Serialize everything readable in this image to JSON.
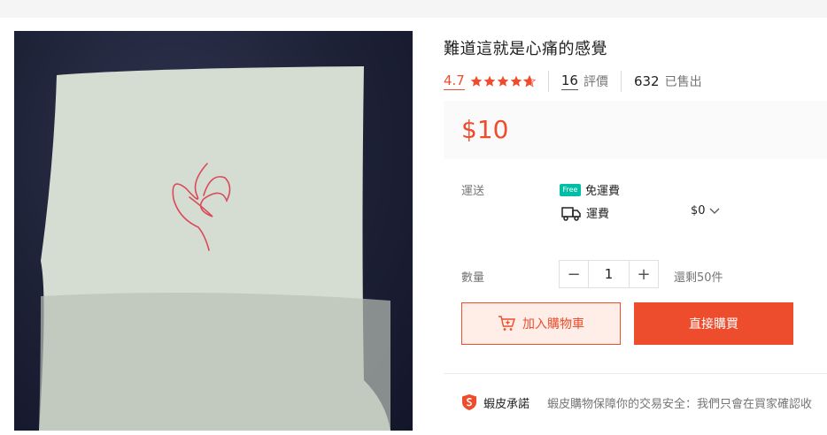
{
  "product": {
    "title": "難道這就是心痛的感覺",
    "image_icon": "product-photo-heart-drawing"
  },
  "rating": {
    "score": "4.7",
    "stars_filled": 4.7,
    "reviews_count": "16",
    "reviews_label": "評價",
    "sold_count": "632",
    "sold_label": "已售出"
  },
  "price": "$10",
  "shipping": {
    "label": "運送",
    "free_badge": "Free",
    "free_text": "免運費",
    "fee_label": "運費",
    "fee_value": "$0"
  },
  "quantity": {
    "label": "數量",
    "minus": "−",
    "value": "1",
    "plus": "+",
    "stock": "還剩50件"
  },
  "actions": {
    "add_to_cart": "加入購物車",
    "buy_now": "直接購買"
  },
  "guarantee": {
    "title": "蝦皮承諾",
    "text": "蝦皮購物保障你的交易安全：我們只會在買家確認收"
  },
  "colors": {
    "accent": "#ee4d2d",
    "free_ship": "#00bfa5"
  }
}
